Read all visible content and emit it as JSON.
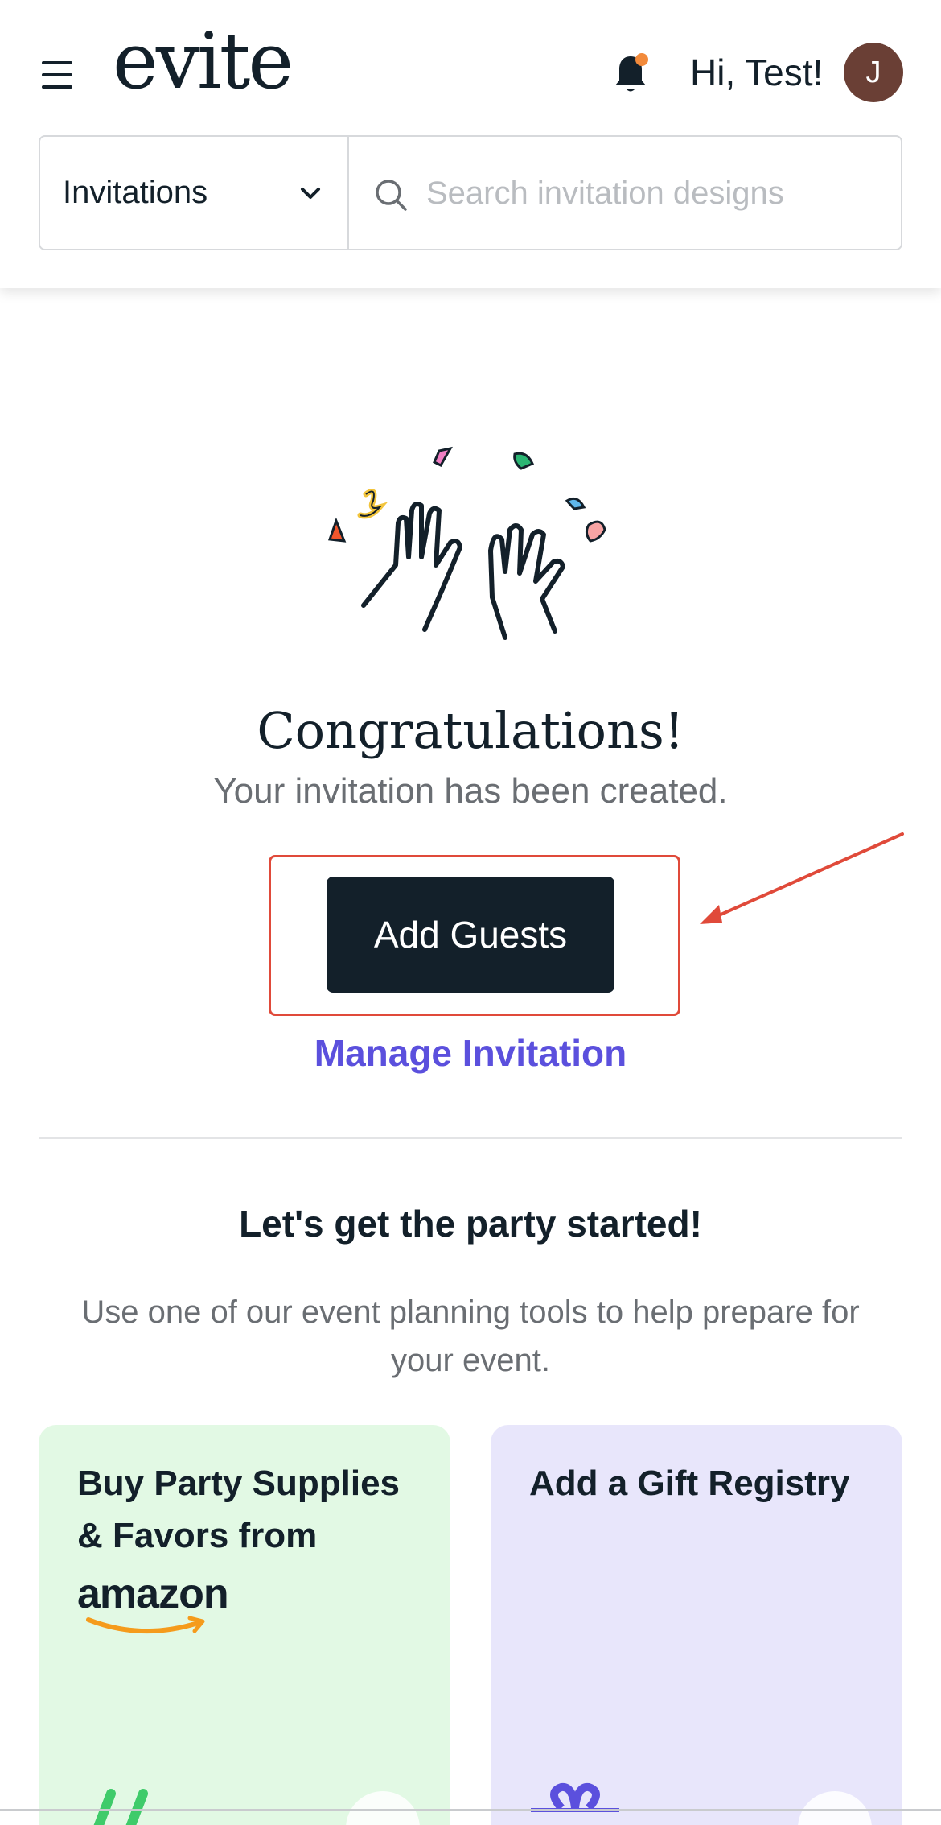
{
  "header": {
    "logo": "evite",
    "greeting": "Hi, Test!",
    "avatar_initial": "J"
  },
  "search": {
    "category": "Invitations",
    "placeholder": "Search invitation designs"
  },
  "confirmation": {
    "title": "Congratulations!",
    "subtitle": "Your invitation has been created.",
    "primary_button": "Add Guests",
    "secondary_link": "Manage Invitation"
  },
  "tools": {
    "title": "Let's get the party started!",
    "description": "Use one of our event planning tools to help prepare for your event.",
    "cards": [
      {
        "title": "Buy Party Supplies & Favors from",
        "brand": "amazon"
      },
      {
        "title": "Add a Gift Registry"
      }
    ]
  },
  "colors": {
    "primary_dark": "#13202a",
    "link_purple": "#5b50dd",
    "annotation_red": "#e04a3a",
    "notification_dot": "#f28a3b",
    "card_green": "#e2f9e4",
    "card_purple": "#e8e6fb"
  },
  "icons": [
    "hamburger-menu-icon",
    "bell-icon",
    "chevron-down-icon",
    "search-icon",
    "celebration-hands-illustration",
    "gift-icon"
  ]
}
